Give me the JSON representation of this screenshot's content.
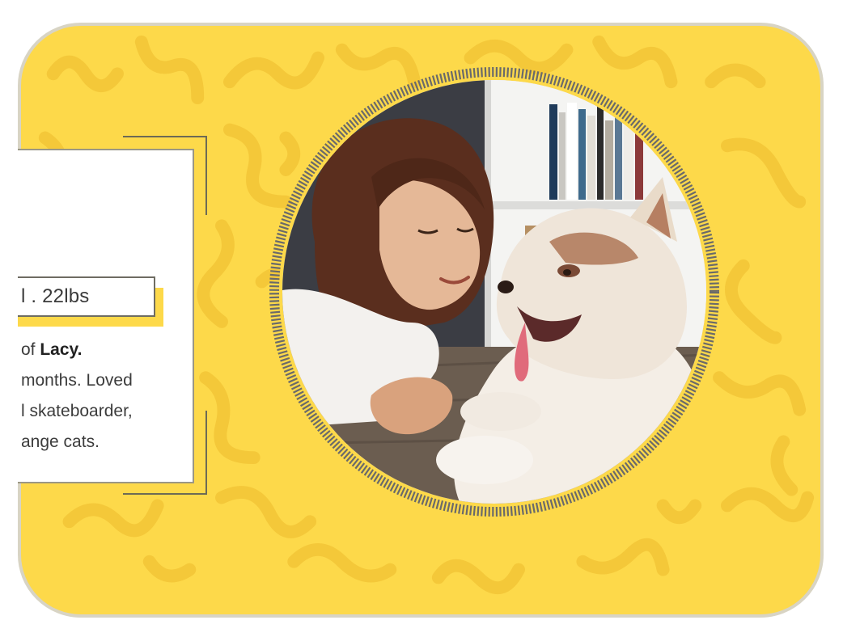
{
  "colors": {
    "background": "#fdd94a",
    "squiggle": "#f2c436",
    "panel": "#ffffff",
    "ring": "#6a6a6a"
  },
  "info": {
    "weight_text": "l . 22lbs",
    "bio_line1_prefix": "of ",
    "bio_line1_name": "Lacy.",
    "bio_line2": " months. Loved",
    "bio_line3": "l skateboarder,",
    "bio_line4": "ange cats."
  },
  "photo": {
    "subject": "woman-with-husky-puppy"
  }
}
